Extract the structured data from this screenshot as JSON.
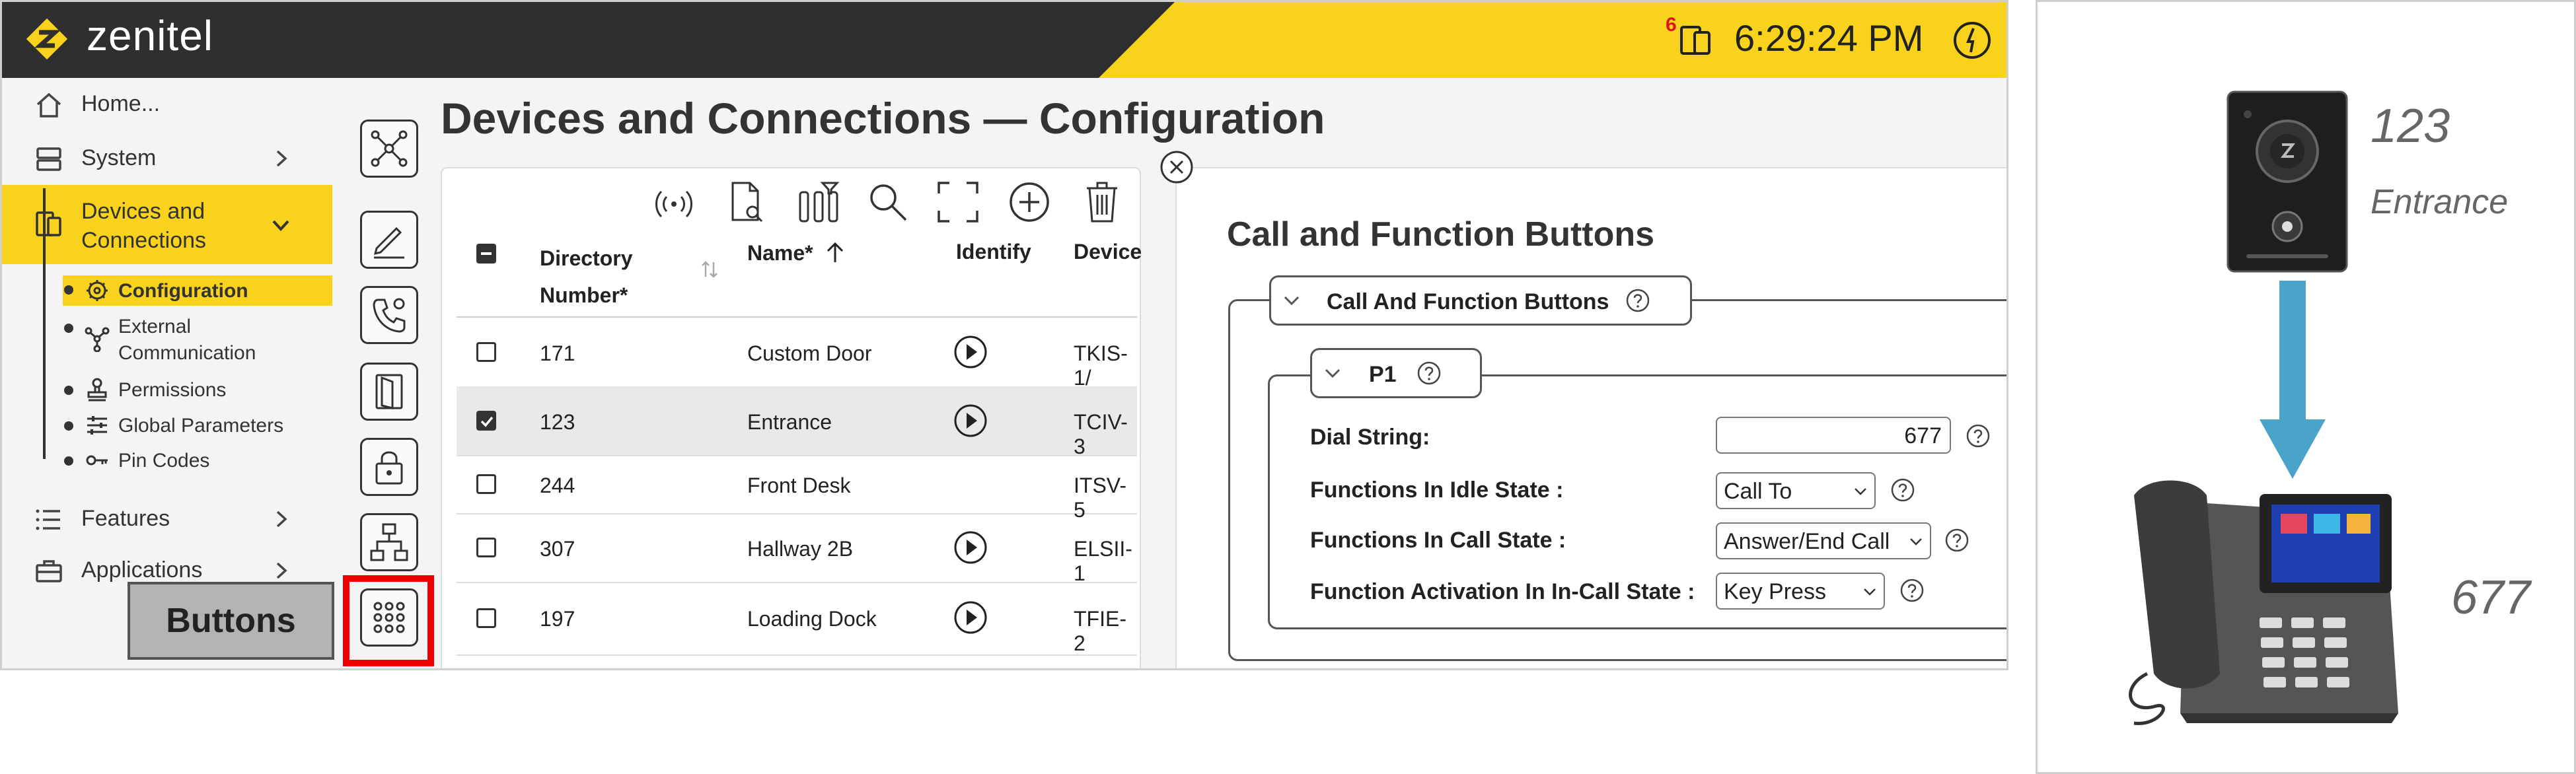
{
  "header": {
    "logo_text": "zenitel",
    "notification_count": "6",
    "time": "6:29:24 PM",
    "brand_color": "#f8d21c"
  },
  "sidebar": {
    "items": [
      {
        "label": "Home...",
        "icon": "home-icon"
      },
      {
        "label": "System",
        "icon": "server-icon"
      },
      {
        "label": "Devices and Connections",
        "icon": "devices-icon"
      },
      {
        "label": "Features",
        "icon": "list-icon"
      },
      {
        "label": "Applications",
        "icon": "briefcase-icon"
      }
    ],
    "subitems": [
      {
        "label": "Configuration",
        "icon": "gear-icon"
      },
      {
        "label": "External Communication",
        "icon": "network-icon"
      },
      {
        "label": "Permissions",
        "icon": "stamp-icon"
      },
      {
        "label": "Global Parameters",
        "icon": "sliders-icon"
      },
      {
        "label": "Pin Codes",
        "icon": "key-icon"
      }
    ]
  },
  "callout": {
    "label": "Buttons"
  },
  "page": {
    "title": "Devices and Connections — Configuration"
  },
  "table": {
    "columns": [
      "Directory Number*",
      "Name*",
      "Identify",
      "Device"
    ],
    "rows": [
      {
        "checked": false,
        "number": "171",
        "name": "Custom Door",
        "identify": true,
        "device": "TKIS-1/"
      },
      {
        "checked": true,
        "number": "123",
        "name": "Entrance",
        "identify": true,
        "device": "TCIV-3"
      },
      {
        "checked": false,
        "number": "244",
        "name": "Front Desk",
        "identify": false,
        "device": "ITSV-5"
      },
      {
        "checked": false,
        "number": "307",
        "name": "Hallway 2B",
        "identify": true,
        "device": "ELSII-1"
      },
      {
        "checked": false,
        "number": "197",
        "name": "Loading Dock",
        "identify": true,
        "device": "TFIE-2"
      }
    ]
  },
  "config": {
    "title": "Call and Function Buttons",
    "group_label": "Call And Function Buttons",
    "subgroup_label": "P1",
    "fields": {
      "dial_string": {
        "label": "Dial String:",
        "value": "677"
      },
      "idle_state": {
        "label": "Functions In Idle State :",
        "value": "Call To"
      },
      "call_state": {
        "label": "Functions In Call State :",
        "value": "Answer/End Call"
      },
      "activation": {
        "label": "Function Activation In In-Call State :",
        "value": "Key Press"
      }
    }
  },
  "illustration": {
    "intercom_number": "123",
    "intercom_name": "Entrance",
    "phone_number": "677",
    "arrow_color": "#4aa3c8"
  }
}
